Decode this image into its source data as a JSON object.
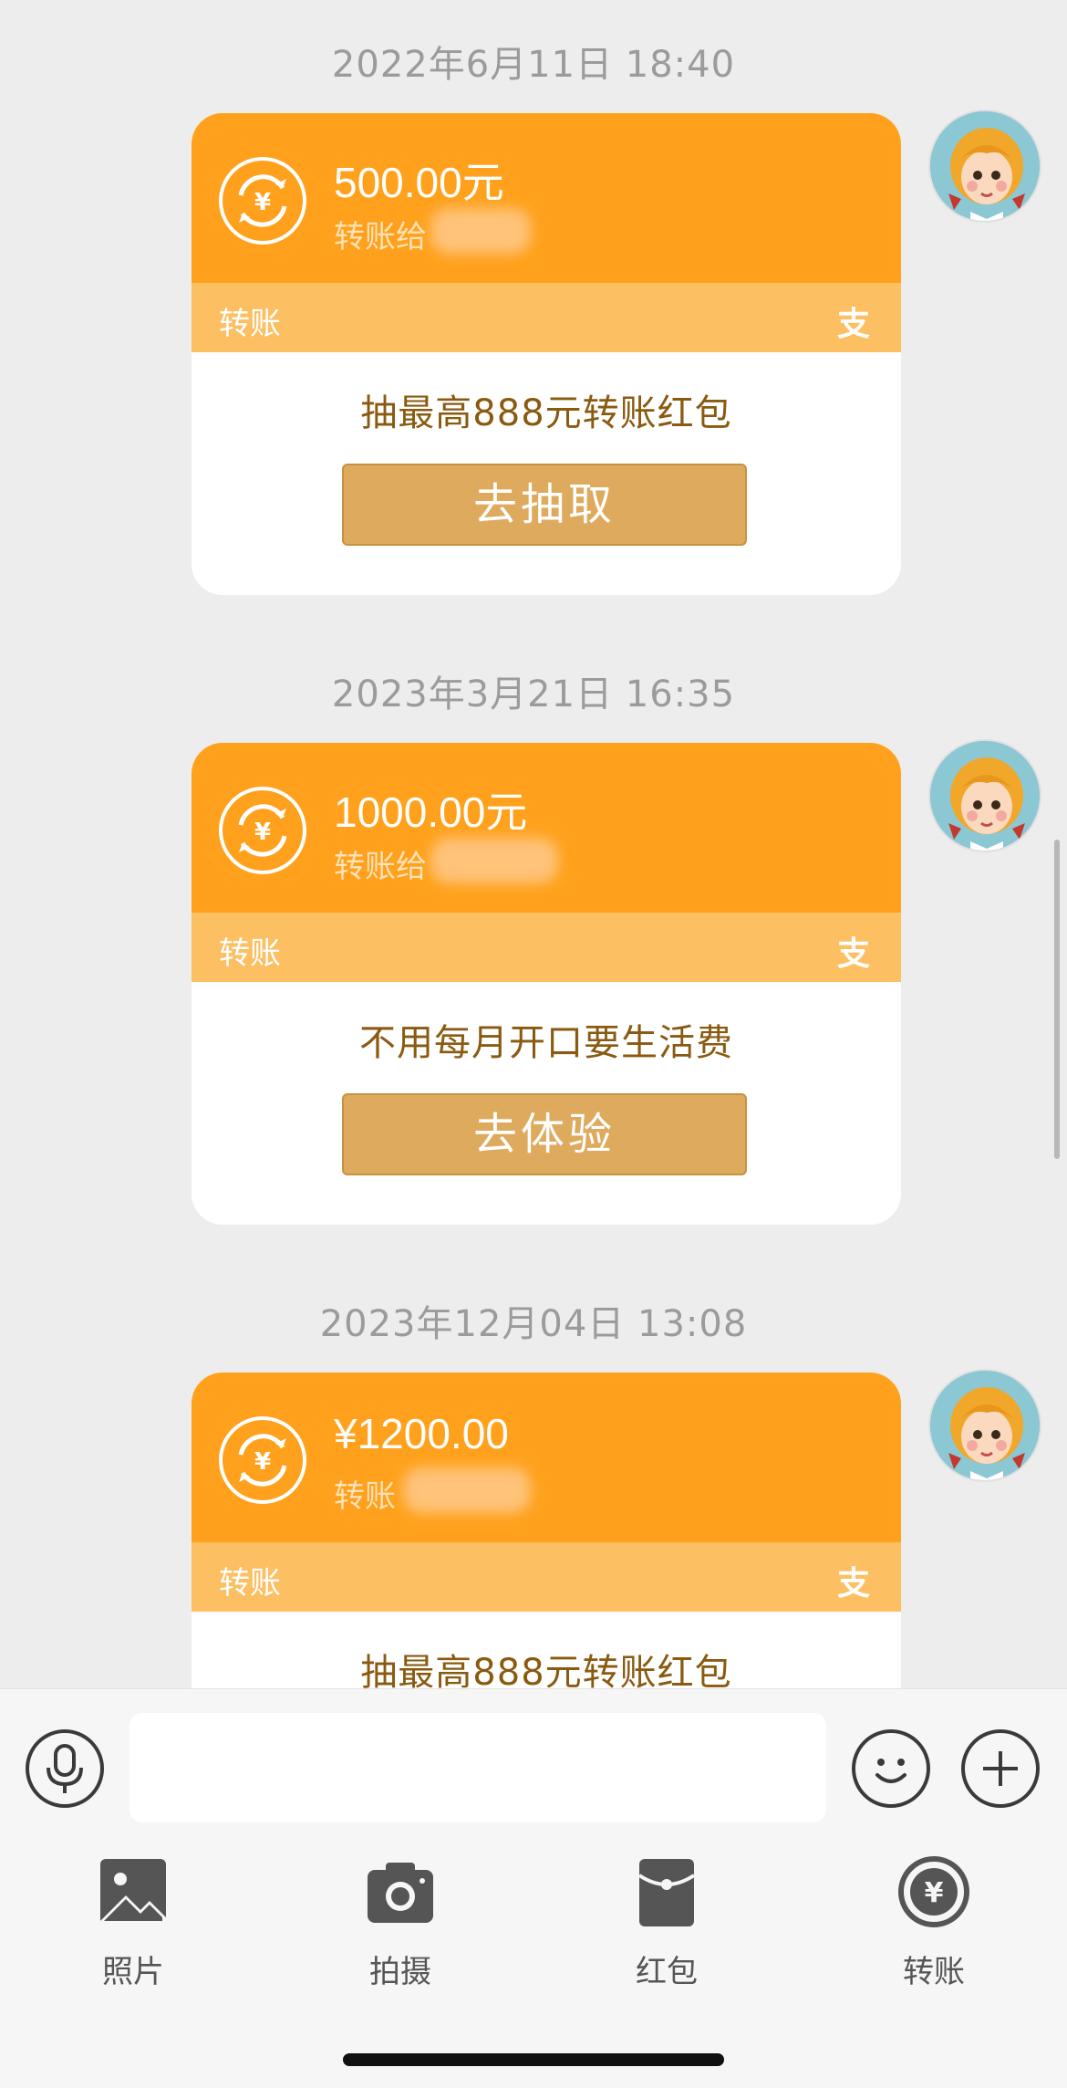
{
  "messages": [
    {
      "timestamp": "2022年6月11日 18:40",
      "amount": "500.00元",
      "sub_label": "转账给",
      "band_label": "转账",
      "band_icon": "支",
      "promo_text": "抽最高888元转账红包",
      "action_label": "去抽取"
    },
    {
      "timestamp": "2023年3月21日 16:35",
      "amount": "1000.00元",
      "sub_label": "转账给",
      "band_label": "转账",
      "band_icon": "支",
      "promo_text": "不用每月开口要生活费",
      "action_label": "去体验"
    },
    {
      "timestamp": "2023年12月04日 13:08",
      "amount": "¥1200.00",
      "sub_label": "转账",
      "band_label": "转账",
      "band_icon": "支",
      "promo_text": "抽最高888元转账红包"
    }
  ],
  "toolbar": {
    "voice_icon": "microphone-icon",
    "emoji_icon": "smiley-icon",
    "plus_icon": "plus-icon",
    "input_value": ""
  },
  "tools": [
    {
      "label": "照片",
      "icon": "image-icon"
    },
    {
      "label": "拍摄",
      "icon": "camera-icon"
    },
    {
      "label": "红包",
      "icon": "red-packet-icon"
    },
    {
      "label": "转账",
      "icon": "transfer-yuan-icon"
    }
  ],
  "colors": {
    "card_orange": "#ffa11c",
    "band_orange": "#fcbf62",
    "button_gold": "#deaa5e",
    "promo_brown": "#8a5a10",
    "background": "#ededed"
  }
}
